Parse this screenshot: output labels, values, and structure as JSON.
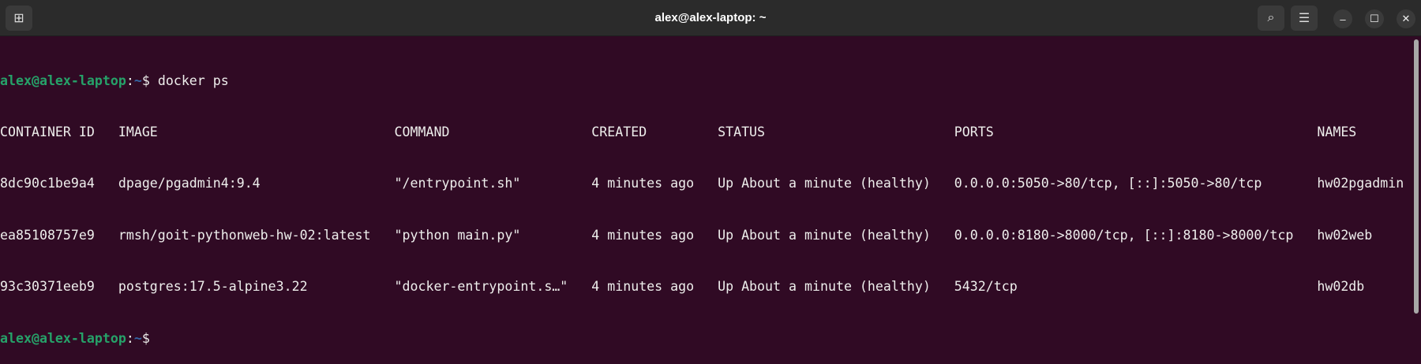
{
  "window": {
    "title": "alex@alex-laptop: ~"
  },
  "prompt": {
    "user_host": "alex@alex-laptop",
    "sep": ":",
    "path": "~",
    "symbol": "$ ",
    "command": "docker ps"
  },
  "table": {
    "headers": [
      "CONTAINER ID",
      "IMAGE",
      "COMMAND",
      "CREATED",
      "STATUS",
      "PORTS",
      "NAMES"
    ],
    "rows": [
      [
        "8dc90c1be9a4",
        "dpage/pgadmin4:9.4",
        "\"/entrypoint.sh\"",
        "4 minutes ago",
        "Up About a minute (healthy)",
        "0.0.0.0:5050->80/tcp, [::]:5050->80/tcp",
        "hw02pgadmin"
      ],
      [
        "ea85108757e9",
        "rmsh/goit-pythonweb-hw-02:latest",
        "\"python main.py\"",
        "4 minutes ago",
        "Up About a minute (healthy)",
        "0.0.0.0:8180->8000/tcp, [::]:8180->8000/tcp",
        "hw02web"
      ],
      [
        "93c30371eeb9",
        "postgres:17.5-alpine3.22",
        "\"docker-entrypoint.s…\"",
        "4 minutes ago",
        "Up About a minute (healthy)",
        "5432/tcp",
        "hw02db"
      ]
    ]
  },
  "icons": {
    "new_tab": "new-tab-icon",
    "search": "search-icon",
    "menu": "hamburger-icon",
    "minimize": "minimize-icon",
    "maximize": "maximize-icon",
    "close": "close-icon"
  }
}
